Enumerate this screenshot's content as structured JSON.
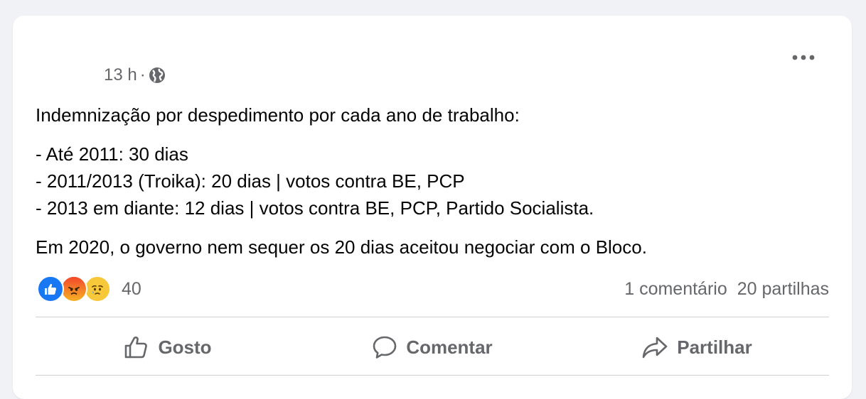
{
  "post": {
    "timestamp": "13 h",
    "separator": "·",
    "audience_icon": "globe-icon",
    "more_icon": "more-dots-icon",
    "text": {
      "intro": "Indemnização por despedimento por cada ano de trabalho:",
      "lines": [
        "- Até 2011: 30 dias",
        "- 2011/2013 (Troika): 20 dias | votos contra BE, PCP",
        "- 2013 em diante: 12 dias | votos contra BE, PCP, Partido Socialista."
      ],
      "closing": "Em  2020, o governo nem sequer os 20 dias aceitou negociar com o Bloco."
    }
  },
  "reactions": {
    "icons": [
      "like-reaction-icon",
      "angry-reaction-icon",
      "sad-reaction-icon"
    ],
    "count": "40"
  },
  "stats": {
    "comments": "1 comentário",
    "shares": "20 partilhas"
  },
  "actions": {
    "like_label": "Gosto",
    "comment_label": "Comentar",
    "share_label": "Partilhar"
  },
  "colors": {
    "text": "#050505",
    "secondary": "#65676b",
    "like_blue": "#1877f2",
    "divider": "#ced0d4",
    "background": "#f0f2f5"
  }
}
